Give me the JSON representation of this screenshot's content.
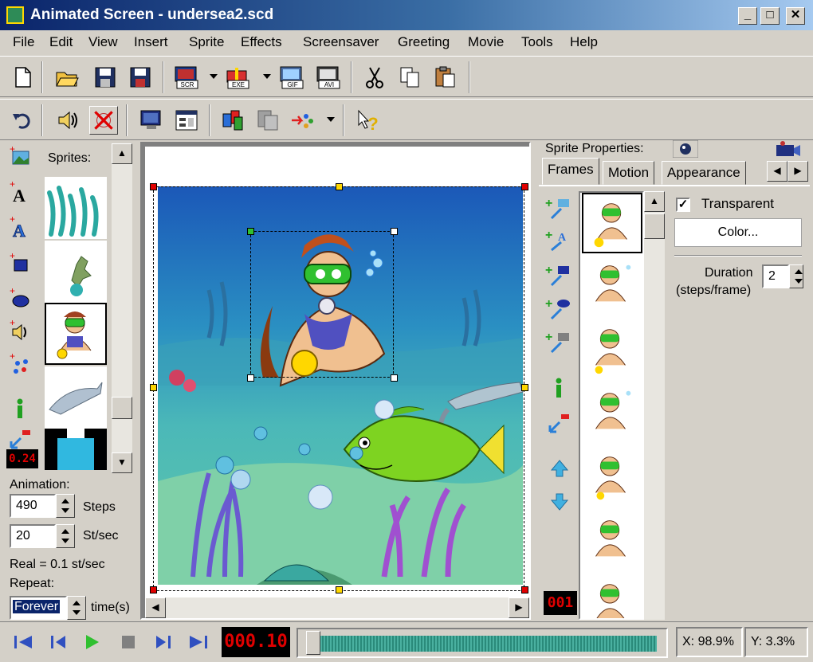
{
  "window": {
    "title": "Animated Screen - undersea2.scd",
    "minimize": "_",
    "maximize": "□",
    "close": "✕"
  },
  "menu": [
    "File",
    "Edit",
    "View",
    "Insert",
    "Sprite",
    "Effects",
    "Screensaver",
    "Greeting",
    "Movie",
    "Tools",
    "Help"
  ],
  "toolbar": {
    "badges": {
      "scr": "SCR",
      "exe": "EXE",
      "gif": "GIF",
      "avi": "AVI"
    }
  },
  "sprites_panel": {
    "label": "Sprites:",
    "counter": "0.24"
  },
  "animation": {
    "label": "Animation:",
    "steps_value": "490",
    "steps_label": "Steps",
    "rate_value": "20",
    "rate_label": "St/sec",
    "real": "Real = 0.1 st/sec",
    "repeat_label": "Repeat:",
    "repeat_value": "Forever",
    "repeat_suffix": "time(s)"
  },
  "sprite_properties": {
    "header": "Sprite Properties:",
    "tabs": [
      "Frames",
      "Motion",
      "Appearance"
    ],
    "transparent_label": "Transparent",
    "transparent_checked": "✓",
    "color_button": "Color...",
    "duration_label": "Duration",
    "duration_sub": "(steps/frame)",
    "duration_value": "2",
    "frame_counter": "001"
  },
  "status": {
    "time": "000.10",
    "x_label": "X: 98.9%",
    "y_label": "Y: 3.3%"
  },
  "colors": {
    "accent_title": "#0a246a",
    "water": "#2a8fc2",
    "fish": "#7ed321",
    "lcd_red": "#e00000"
  }
}
